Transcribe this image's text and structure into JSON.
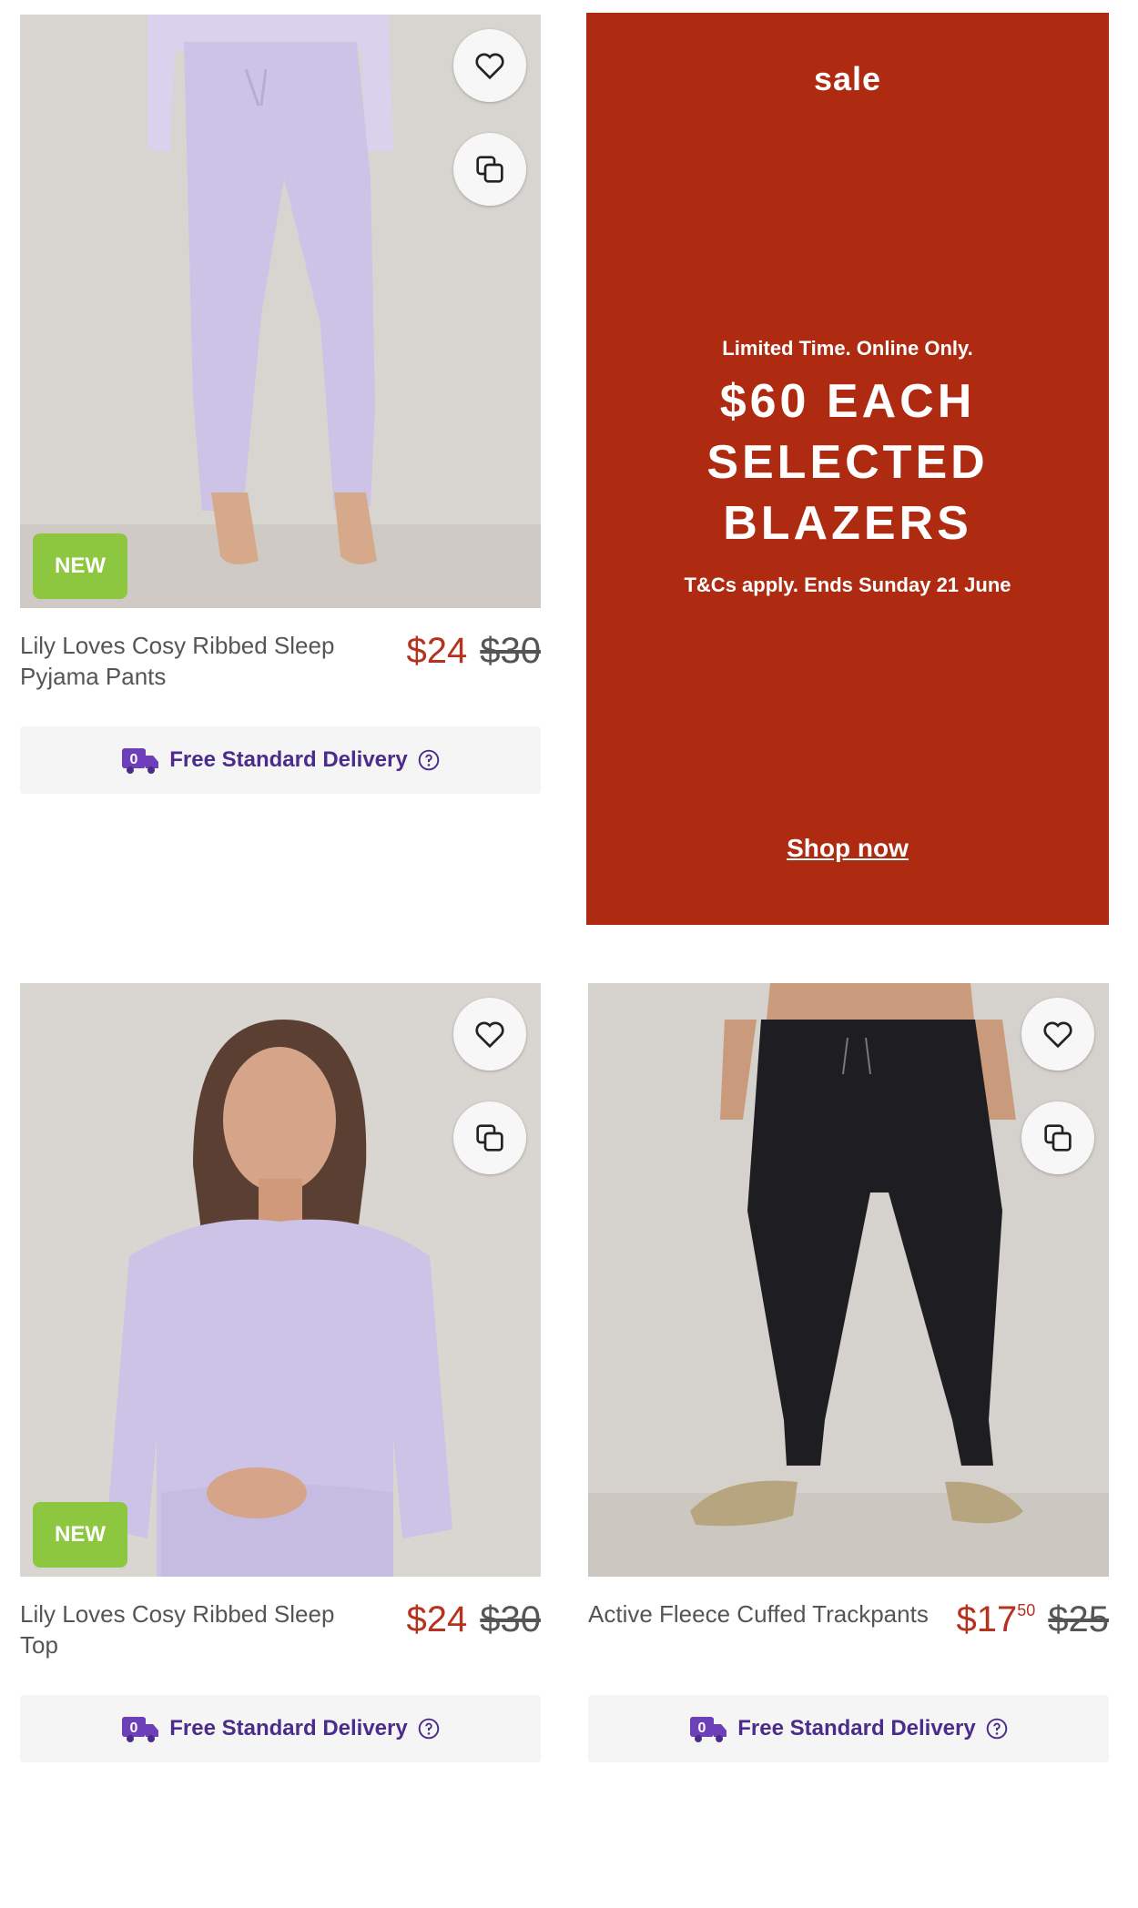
{
  "products": [
    {
      "name": "Lily Loves Cosy Ribbed Sleep Pyjama Pants",
      "badge": "NEW",
      "price": "$24",
      "was_price": "$30",
      "delivery": "Free Standard Delivery"
    },
    {
      "name": "Lily Loves Cosy Ribbed Sleep Top",
      "badge": "NEW",
      "price": "$24",
      "was_price": "$30",
      "delivery": "Free Standard Delivery"
    },
    {
      "name": "Active Fleece Cuffed Trackpants",
      "price_main": "$17",
      "price_cents": "50",
      "was_price": "$25",
      "delivery": "Free Standard Delivery"
    }
  ],
  "promo": {
    "tag": "sale",
    "subline": "Limited Time. Online Only.",
    "headline_1": "$60 EACH",
    "headline_2": "SELECTED",
    "headline_3": "BLAZERS",
    "terms": "T&Cs apply. Ends Sunday 21 June",
    "cta": "Shop now"
  },
  "colors": {
    "sale_red": "#b5331e",
    "promo_bg": "#ae2b12",
    "new_badge": "#8dc63f",
    "delivery_purple": "#4b2c8a"
  },
  "icons": {
    "wishlist": "heart-icon",
    "quick_view": "copy-icon",
    "delivery": "truck-icon",
    "help": "question-circle-icon"
  }
}
